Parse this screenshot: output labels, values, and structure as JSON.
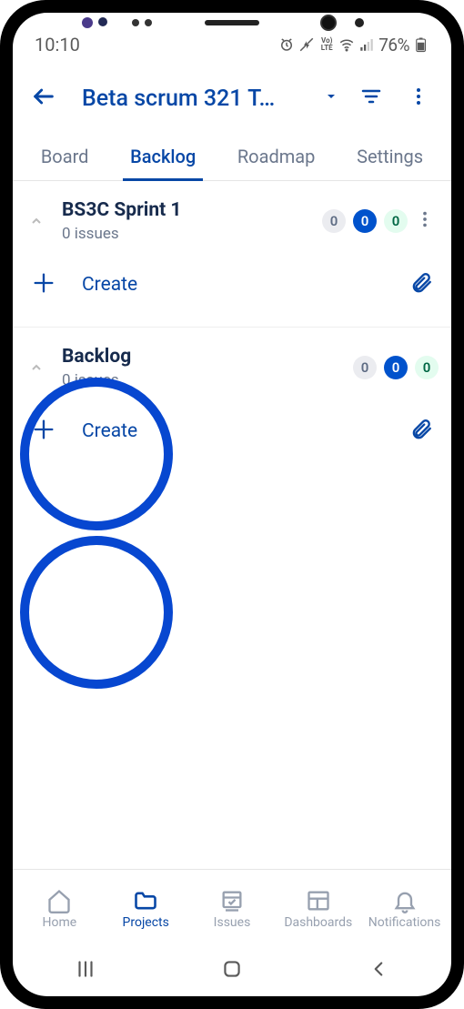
{
  "status": {
    "time": "10:10",
    "battery": "76%"
  },
  "header": {
    "project_title": "Beta scrum 321 T…"
  },
  "tabs": [
    {
      "label": "Board",
      "active": false
    },
    {
      "label": "Backlog",
      "active": true
    },
    {
      "label": "Roadmap",
      "active": false
    },
    {
      "label": "Settings",
      "active": false
    }
  ],
  "sections": [
    {
      "title": "BS3C Sprint 1",
      "subtitle": "0 issues",
      "badges": {
        "gray": "0",
        "blue": "0",
        "green": "0"
      },
      "create_label": "Create",
      "has_menu": true
    },
    {
      "title": "Backlog",
      "subtitle": "0 issues",
      "badges": {
        "gray": "0",
        "blue": "0",
        "green": "0"
      },
      "create_label": "Create",
      "has_menu": false
    }
  ],
  "bottom_nav": [
    {
      "label": "Home"
    },
    {
      "label": "Projects"
    },
    {
      "label": "Issues"
    },
    {
      "label": "Dashboards"
    },
    {
      "label": "Notifications"
    }
  ]
}
